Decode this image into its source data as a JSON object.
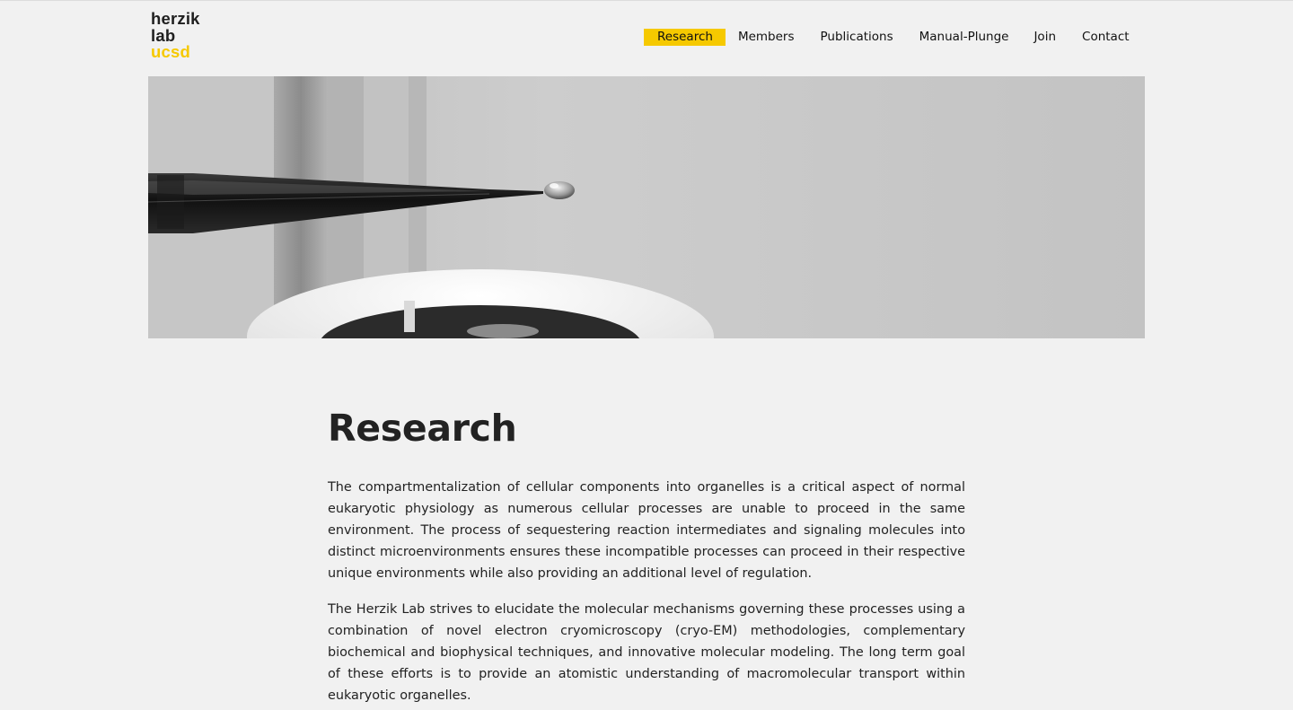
{
  "logo": {
    "line1": "herzik",
    "line2": "lab",
    "line3": "ucsd",
    "accent_color": "#f6c900"
  },
  "nav": {
    "items": [
      {
        "label": "Research",
        "active": true
      },
      {
        "label": "Members",
        "active": false
      },
      {
        "label": "Publications",
        "active": false
      },
      {
        "label": "Manual-Plunge",
        "active": false
      },
      {
        "label": "Join",
        "active": false
      },
      {
        "label": "Contact",
        "active": false
      }
    ]
  },
  "hero": {
    "image": "black-and-white photo of a pipette tip holding a droplet above a cryo-EM grid holder"
  },
  "main": {
    "title": "Research",
    "paragraphs": [
      "The compartmentalization of cellular components into organelles is a critical aspect of normal eukaryotic physiology as numerous cellular processes are unable to proceed in the same environment. The process of sequestering reaction intermediates and signaling molecules into distinct microenvironments ensures these incompatible processes can proceed in their respective unique environments while also providing an additional level of regulation.",
      "The Herzik Lab strives to elucidate the molecular mechanisms governing these processes using a combination of novel electron cryomicroscopy (cryo-EM) methodologies, complementary biochemical and biophysical techniques, and innovative molecular modeling. The long term goal of these efforts is to provide an atomistic understanding of macromolecular transport within eukaryotic organelles."
    ]
  }
}
